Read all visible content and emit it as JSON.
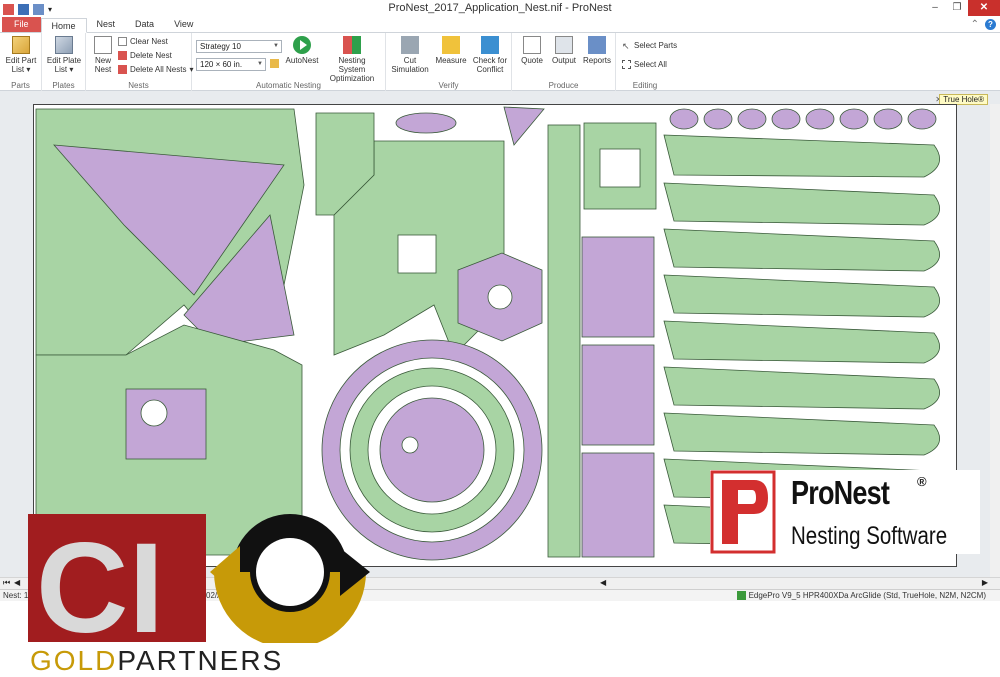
{
  "window": {
    "title": "ProNest_2017_Application_Nest.nif - ProNest",
    "controls": [
      "–",
      "❐",
      "✕"
    ]
  },
  "tabs": [
    {
      "label": "File"
    },
    {
      "label": "Home"
    },
    {
      "label": "Nest"
    },
    {
      "label": "Data"
    },
    {
      "label": "View"
    }
  ],
  "ribbon": {
    "parts": {
      "label": "Parts",
      "edit_part_list": "Edit Part List ▾"
    },
    "plates": {
      "label": "Plates",
      "edit_plate_list": "Edit Plate List ▾"
    },
    "nests": {
      "label": "Nests",
      "new_nest": "New Nest",
      "clear_nest": "Clear Nest",
      "delete_nest": "Delete Nest",
      "delete_all_nests": "Delete All Nests"
    },
    "automatic_nesting": {
      "label": "Automatic Nesting",
      "strategy": "Strategy 10",
      "plate_size": "120 × 60 in.",
      "autonest": "AutoNest",
      "optimization": "Nesting System Optimization"
    },
    "verify": {
      "label": "Verify",
      "cut_simulation": "Cut Simulation",
      "measure": "Measure",
      "check_conflict": "Check for Conflict"
    },
    "produce": {
      "label": "Produce",
      "quote": "Quote",
      "output": "Output",
      "reports": "Reports"
    },
    "editing": {
      "label": "Editing",
      "select_parts": "Select Parts",
      "select_all": "Select All"
    }
  },
  "canvas": {
    "truehole_label": "True Hole®",
    "part_colors": {
      "green": "#a8d4a4",
      "purple": "#c3a6d6",
      "outline": "#3a5a3a"
    }
  },
  "statusbar": {
    "left": "Nest: 1",
    "middle": "02/A",
    "right": "EdgePro V9_5 HPR400XDa ArcGlide (Std, TrueHole, N2M, N2CM)"
  },
  "logos": {
    "pronest_name": "ProNest",
    "pronest_reg": "®",
    "pronest_sub": "Nesting Software",
    "ci_letters": "CI",
    "gold_word": "GOLD",
    "partners_word": "PARTNERS"
  }
}
